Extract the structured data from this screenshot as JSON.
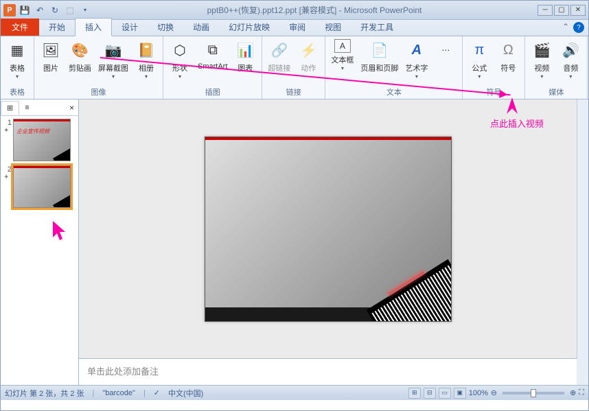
{
  "title": "pptB0++(恢复).ppt12.ppt [兼容模式] - Microsoft PowerPoint",
  "tabs": {
    "file": "文件",
    "home": "开始",
    "insert": "插入",
    "design": "设计",
    "transition": "切换",
    "animation": "动画",
    "slideshow": "幻灯片放映",
    "review": "审阅",
    "view": "视图",
    "developer": "开发工具"
  },
  "ribbon": {
    "tables": {
      "label": "表格",
      "table": "表格"
    },
    "images": {
      "label": "图像",
      "picture": "图片",
      "clipart": "剪贴画",
      "screenshot": "屏幕截图",
      "album": "相册"
    },
    "illustrations": {
      "label": "插图",
      "shapes": "形状",
      "smartart": "SmartArt",
      "chart": "图表"
    },
    "links": {
      "label": "链接",
      "hyperlink": "超链接",
      "action": "动作"
    },
    "text": {
      "label": "文本",
      "textbox": "文本框",
      "headerfooter": "页眉和页脚",
      "wordart": "艺术字"
    },
    "symbols": {
      "label": "符号",
      "equation": "公式",
      "symbol": "符号"
    },
    "media": {
      "label": "媒体",
      "video": "视频",
      "audio": "音频"
    }
  },
  "panel": {
    "slides_tab": "⊞",
    "outline_tab": "≡",
    "close": "×"
  },
  "thumbs": [
    {
      "num": "1",
      "anim": "✦",
      "text": "企业宣传视频"
    },
    {
      "num": "2",
      "anim": "✦"
    }
  ],
  "notes_placeholder": "单击此处添加备注",
  "status": {
    "slide": "幻灯片 第 2 张，共 2 张",
    "theme": "\"barcode\"",
    "lang": "中文(中国)",
    "zoom": "100%"
  },
  "annotations": {
    "video_hint": "点此插入视频"
  }
}
